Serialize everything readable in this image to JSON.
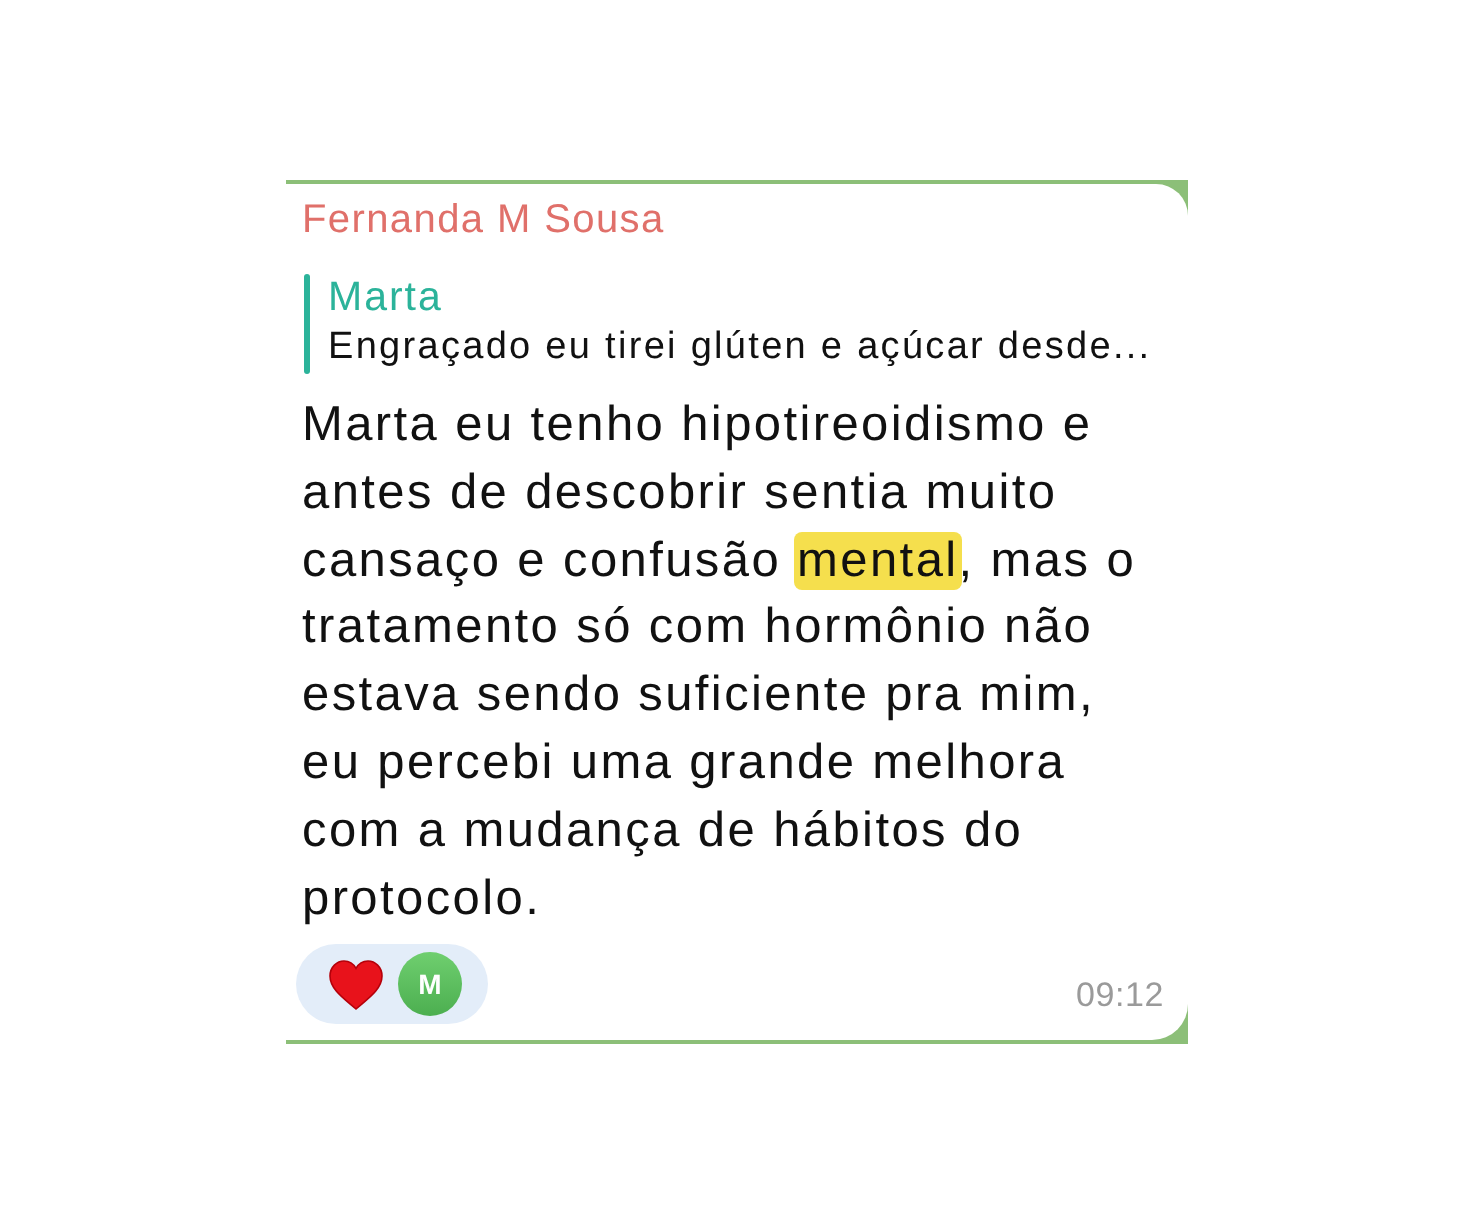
{
  "message": {
    "sender": "Fernanda M Sousa",
    "reply": {
      "author": "Marta",
      "text": "Engraçado eu tirei glúten e açúcar desde..."
    },
    "body": [
      {
        "text": "Marta eu tenho hipotireoidismo e antes de descobrir sentia muito cansaço e confusão ",
        "highlighted": false
      },
      {
        "text": "mental",
        "highlighted": true
      },
      {
        "text": ", mas o tratamento só com hormônio não estava sendo suficiente pra mim, eu percebi uma grande melhora com a mudança de hábitos do protocolo.",
        "highlighted": false
      }
    ],
    "reactions": [
      {
        "kind": "heart",
        "avatar": "M"
      }
    ],
    "time": "09:12"
  }
}
